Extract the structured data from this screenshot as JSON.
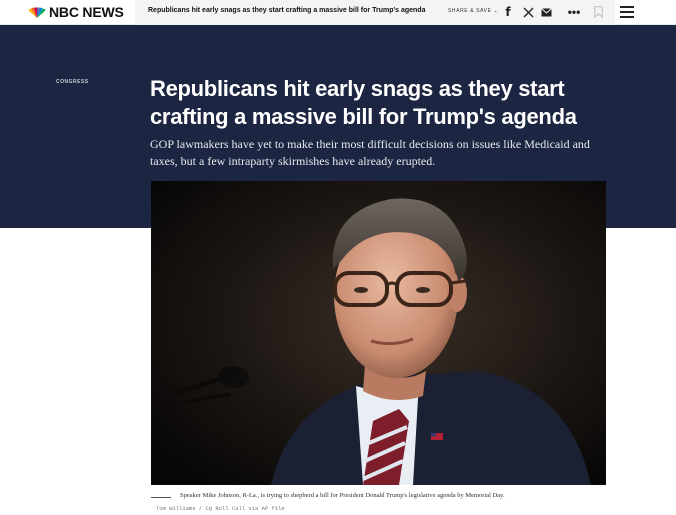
{
  "header": {
    "brand": "NBC NEWS",
    "strip_title": "Republicans hit early snags as they start crafting a massive bill for Trump's agenda",
    "share_label": "SHARE & SAVE",
    "icons": [
      "peacock-logo-icon",
      "facebook-icon",
      "x-icon",
      "mail-icon",
      "more-icon",
      "bookmark-icon",
      "menu-icon"
    ]
  },
  "article": {
    "category": "CONGRESS",
    "title": "Republicans hit early snags as they start crafting a massive bill for Trump's agenda",
    "dek": "GOP lawmakers have yet to make their most difficult decisions on issues like Medicaid and taxes, but a few intraparty skirmishes have already erupted.",
    "caption": "Speaker Mike Johnson, R-La., is trying to shepherd a bill for President Donald Trump's legislative agenda by Memorial Day.",
    "credit": "Tom Williams / CQ Roll Call via AP file"
  },
  "colors": {
    "hero_background": "#1c2541",
    "page_background": "#ffffff",
    "strip_background": "#f4f4f4"
  }
}
